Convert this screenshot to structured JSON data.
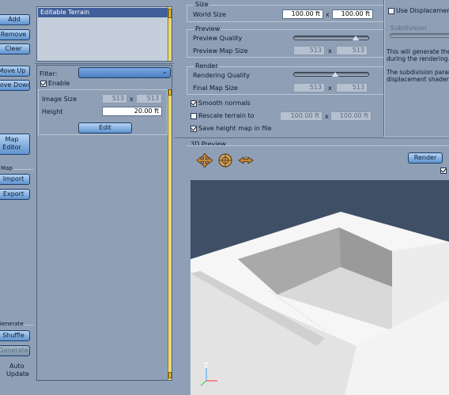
{
  "left": {
    "buttons": {
      "add": "Add",
      "remove": "Remove",
      "clear": "Clear",
      "move_up": "Move Up",
      "move_down": "Move Down",
      "map_editor_line1": "Map",
      "map_editor_line2": "Editor",
      "import": "Import",
      "export": "Export",
      "shuffle": "Shuffle",
      "generate": "Generate"
    },
    "group_map_label": "Map",
    "group_generate_label": "Generate",
    "auto_update_line1": "Auto",
    "auto_update_line2": "Update"
  },
  "middle": {
    "list_items": [
      "Editable Terrain"
    ],
    "filter_label": "Filter:",
    "filter_value": "",
    "enable_label": "Enable",
    "enable_checked": true,
    "image_size_label": "Image Size",
    "image_size_w": "513",
    "image_size_h": "513",
    "x_sep": "x",
    "height_label": "Height",
    "height_value": "20.00 ft",
    "edit_button": "Edit"
  },
  "right": {
    "size_title": "Size",
    "world_size_label": "World Size",
    "world_size_w": "100.00 ft",
    "world_size_h": "100.00 ft",
    "x_sep": "x",
    "preview_title": "Preview",
    "preview_quality_label": "Preview Quality",
    "preview_quality_level": 0.82,
    "preview_map_size_label": "Preview Map Size",
    "preview_map_w": "513",
    "preview_map_h": "513",
    "render_title": "Render",
    "rendering_quality_label": "Rendering Quality",
    "rendering_quality_level": 0.55,
    "final_map_size_label": "Final Map Size",
    "final_map_w": "513",
    "final_map_h": "513",
    "smooth_normals_label": "Smooth normals",
    "smooth_normals_checked": true,
    "rescale_label": "Rescale terrain to",
    "rescale_checked": false,
    "rescale_w": "100.00 ft",
    "rescale_h": "100.00 ft",
    "save_height_label": "Save height map in file",
    "save_height_checked": true,
    "use_displacement_label": "Use Displacement",
    "use_displacement_checked": false,
    "subdivision_label": "Subdivision",
    "info_line1": "This will generate the",
    "info_line2": "during the rendering.",
    "info_line3": "The subdivision param",
    "info_line4": "displacement shader a",
    "preview_3d_title": "3D Preview",
    "render_button": "Render",
    "auto_render_checked": true,
    "axis_z_label": "Z",
    "viewport": {
      "background_color": "#3e4f66",
      "terrain_color": "#f4f4f4"
    },
    "tool_icons": [
      "move-icon",
      "rotate-icon",
      "zoom-icon"
    ]
  }
}
